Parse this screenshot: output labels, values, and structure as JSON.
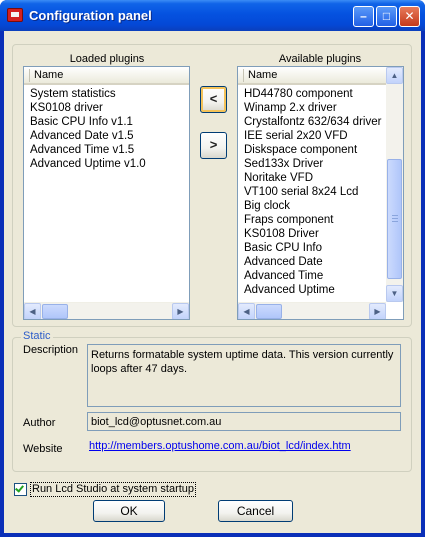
{
  "window": {
    "title": "Configuration panel",
    "controls": {
      "minimize": "–",
      "maximize": "□",
      "close": "✕"
    }
  },
  "loaded": {
    "label": "Loaded plugins",
    "column": "Name",
    "items": [
      "System statistics",
      "KS0108 driver",
      "Basic CPU Info v1.1",
      "Advanced Date v1.5",
      "Advanced Time v1.5",
      "Advanced Uptime v1.0"
    ]
  },
  "available": {
    "label": "Available plugins",
    "column": "Name",
    "items": [
      "HD44780 component",
      "Winamp 2.x driver",
      "Crystalfontz 632/634 driver",
      "IEE serial 2x20 VFD",
      "Diskspace component",
      "Sed133x Driver",
      "Noritake  VFD",
      "VT100 serial 8x24 Lcd",
      "Big clock",
      "Fraps component",
      "KS0108 Driver",
      "Basic CPU Info",
      "Advanced Date",
      "Advanced Time",
      "Advanced Uptime"
    ]
  },
  "transfer": {
    "left": "<",
    "right": ">"
  },
  "static": {
    "label": "Static",
    "description_label": "Description",
    "description": "Returns formatable system uptime data. This version currently loops after 47 days.",
    "author_label": "Author",
    "author": "biot_lcd@optusnet.com.au",
    "website_label": "Website",
    "website": "http://members.optushome.com.au/biot_lcd/index.htm"
  },
  "startup": {
    "label": "Run Lcd Studio at system startup",
    "checked": true
  },
  "buttons": {
    "ok": "OK",
    "cancel": "Cancel"
  },
  "scroll_icons": {
    "left": "◀",
    "right": "▶",
    "up": "▲",
    "down": "▼"
  }
}
